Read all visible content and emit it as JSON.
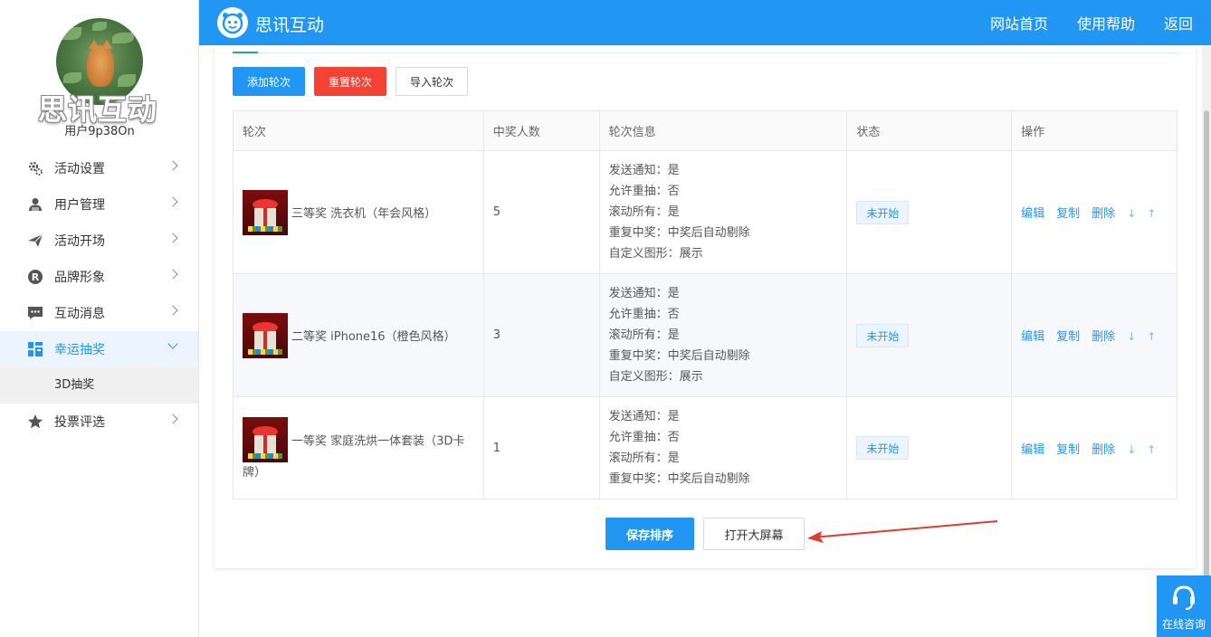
{
  "sidebar": {
    "brand_watermark": "思讯互动",
    "username": "用户9p38On",
    "items": [
      {
        "label": "活动设置",
        "icon": "gear-icon"
      },
      {
        "label": "用户管理",
        "icon": "user-icon"
      },
      {
        "label": "活动开场",
        "icon": "paper-plane-icon"
      },
      {
        "label": "品牌形象",
        "icon": "registered-icon"
      },
      {
        "label": "互动消息",
        "icon": "chat-icon"
      },
      {
        "label": "幸运抽奖",
        "icon": "lottery-icon"
      },
      {
        "label": "投票评选",
        "icon": "star-icon"
      }
    ],
    "sub_items": [
      "3D抽奖"
    ]
  },
  "header": {
    "brand": "思讯互动",
    "nav": [
      "网站首页",
      "使用帮助",
      "返回"
    ]
  },
  "toolbar": {
    "add_round": "添加轮次",
    "reset_round": "重置轮次",
    "import_round": "导入轮次"
  },
  "table": {
    "columns": [
      "轮次",
      "中奖人数",
      "轮次信息",
      "状态",
      "操作"
    ],
    "rows": [
      {
        "prize": "三等奖 洗衣机（年会风格）",
        "winners": "5",
        "info": [
          "发送通知：是",
          "允许重抽：否",
          "滚动所有：是",
          "重复中奖：中奖后自动剔除",
          "自定义图形：展示"
        ],
        "status": "未开始"
      },
      {
        "prize": "二等奖 iPhone16（橙色风格）",
        "winners": "3",
        "info": [
          "发送通知：是",
          "允许重抽：否",
          "滚动所有：是",
          "重复中奖：中奖后自动剔除",
          "自定义图形：展示"
        ],
        "status": "未开始"
      },
      {
        "prize": "一等奖 家庭洗烘一体套装（3D卡牌）",
        "winners": "1",
        "info": [
          "发送通知：是",
          "允许重抽：否",
          "滚动所有：是",
          "重复中奖：中奖后自动剔除"
        ],
        "status": "未开始"
      }
    ],
    "ops": {
      "edit": "编辑",
      "copy": "复制",
      "delete": "删除",
      "down": "↓",
      "up": "↑"
    }
  },
  "footer_buttons": {
    "save_order": "保存排序",
    "open_screen": "打开大屏幕"
  },
  "consult": {
    "label": "在线咨询"
  },
  "colors": {
    "primary": "#2196f3",
    "danger": "#f44336",
    "annotation_arrow": "#e53935"
  }
}
